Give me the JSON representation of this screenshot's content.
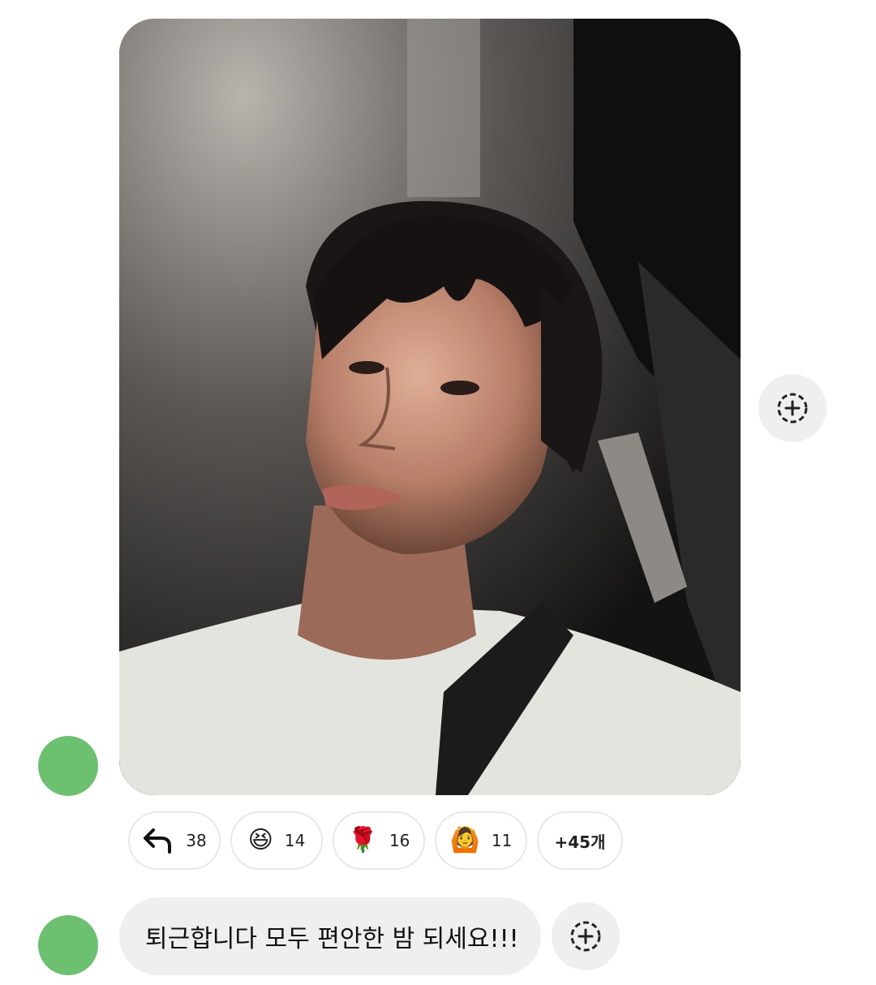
{
  "photo_message": {
    "image_alt": "selfie photo in car at night"
  },
  "reactions": [
    {
      "icon": "reply-arrow-icon",
      "count": "38"
    },
    {
      "icon": "laughing-face-icon",
      "emoji": "😆",
      "count": "14"
    },
    {
      "icon": "rose-icon",
      "emoji": "🌹",
      "count": "16"
    },
    {
      "icon": "person-heart-icon",
      "emoji": "🙆",
      "count": "11"
    }
  ],
  "more_reactions": "+45개",
  "text_message": "퇴근합니다 모두 편안한 밤 되세요!!!",
  "avatar_label": "",
  "colors": {
    "avatar_bg": "#6cc070",
    "bubble_bg": "#efefef",
    "chip_border": "#e8e8e8"
  }
}
